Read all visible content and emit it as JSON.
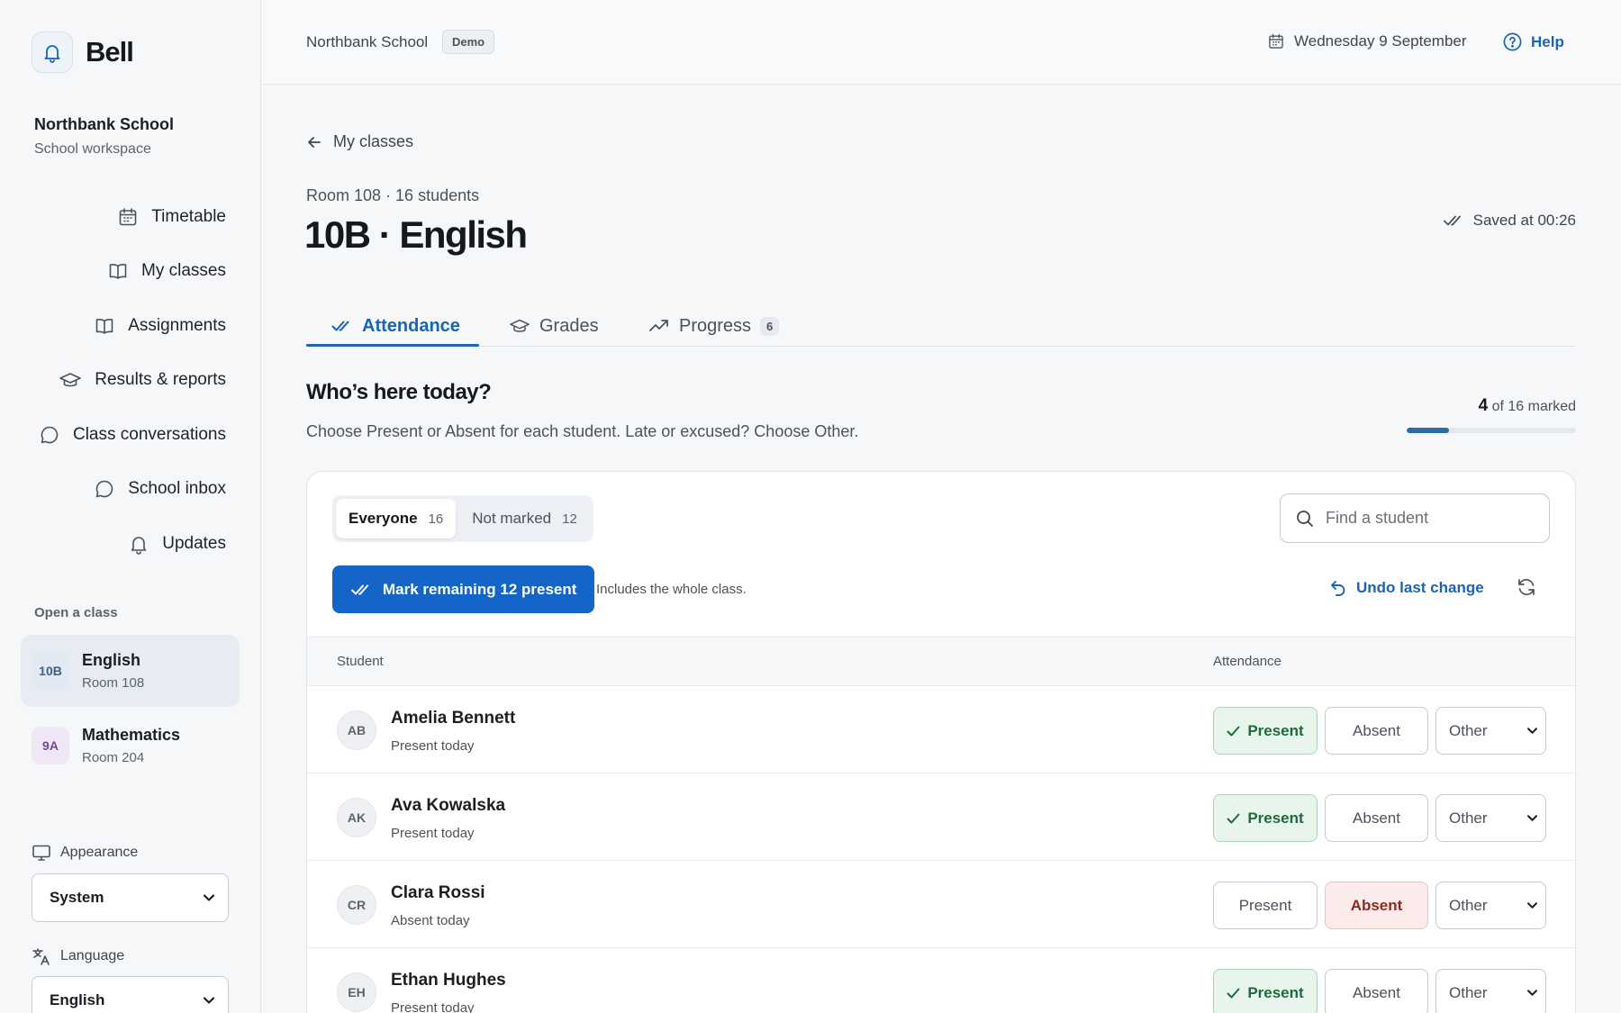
{
  "app": {
    "name": "Bell"
  },
  "workspace": {
    "name": "Northbank School",
    "type": "School workspace"
  },
  "nav": [
    {
      "label": "Timetable",
      "icon": "calendar-icon"
    },
    {
      "label": "My classes",
      "icon": "book-icon"
    },
    {
      "label": "Assignments",
      "icon": "book-icon"
    },
    {
      "label": "Results & reports",
      "icon": "graduation-cap-icon"
    },
    {
      "label": "Class conversations",
      "icon": "chat-bubble-icon"
    },
    {
      "label": "School inbox",
      "icon": "chat-bubble-icon"
    },
    {
      "label": "Updates",
      "icon": "bell-icon"
    }
  ],
  "classes": {
    "section_label": "Open a class",
    "items": [
      {
        "badge": "10B",
        "name": "English",
        "room": "Room 108",
        "badge_bg": "#e3e9f2",
        "badge_color": "#3d5f8c"
      },
      {
        "badge": "9A",
        "name": "Mathematics",
        "room": "Room 204",
        "badge_bg": "#efe7f6",
        "badge_color": "#6f4c8f"
      }
    ]
  },
  "settings": {
    "appearance_label": "Appearance",
    "appearance_value": "System",
    "language_label": "Language",
    "language_value": "English"
  },
  "topbar": {
    "school": "Northbank School",
    "badge": "Demo",
    "date": "Wednesday 9 September",
    "help": "Help"
  },
  "page": {
    "back_label": "My classes",
    "meta": "Room 108 · 16 students",
    "title": "10B · English",
    "saved": "Saved at 00:26"
  },
  "tabs": [
    {
      "label": "Attendance",
      "active": true
    },
    {
      "label": "Grades",
      "active": false
    },
    {
      "label": "Progress",
      "count": "6",
      "active": false
    }
  ],
  "attendance": {
    "heading": "Who’s here today?",
    "instructions": "Choose Present or Absent for each student. Late or excused? Choose Other.",
    "marked_count": "4",
    "marked_suffix": "of 16 marked",
    "progress": 0.25,
    "filters": [
      {
        "label": "Everyone",
        "count": "16",
        "active": true
      },
      {
        "label": "Not marked",
        "count": "12",
        "active": false
      }
    ],
    "search_placeholder": "Find a student",
    "primary_action": "Mark remaining 12 present",
    "primary_note": "Includes the whole class.",
    "undo": "Undo last change",
    "columns": {
      "student": "Student",
      "attendance": "Attendance"
    },
    "options": {
      "present": "Present",
      "absent": "Absent",
      "other": "Other"
    },
    "students": [
      {
        "initials": "AB",
        "name": "Amelia Bennett",
        "status": "Present today",
        "mark": "present"
      },
      {
        "initials": "AK",
        "name": "Ava Kowalska",
        "status": "Present today",
        "mark": "present"
      },
      {
        "initials": "CR",
        "name": "Clara Rossi",
        "status": "Absent today",
        "mark": "absent"
      },
      {
        "initials": "EH",
        "name": "Ethan Hughes",
        "status": "Present today",
        "mark": "present"
      }
    ]
  }
}
